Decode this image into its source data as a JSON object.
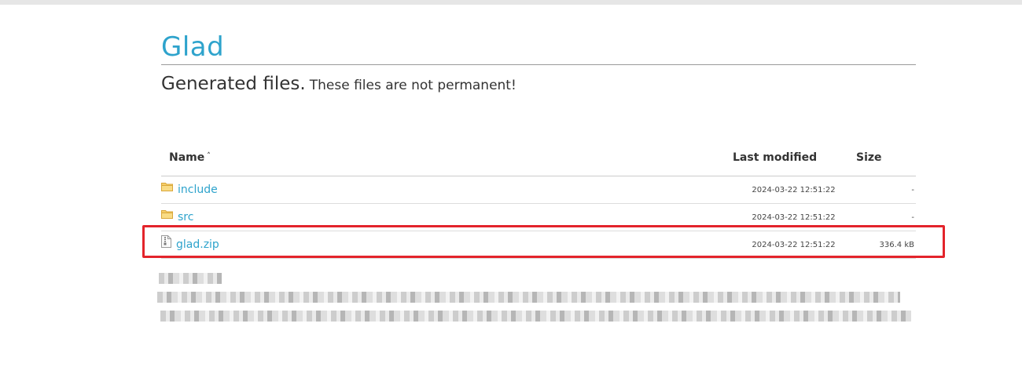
{
  "header": {
    "title": "Glad",
    "subtitle_main": "Generated files.",
    "subtitle_note": "These files are not permanent!"
  },
  "listing": {
    "columns": {
      "name": "Name",
      "sort_indicator": "˄",
      "last_modified": "Last modified",
      "size": "Size"
    },
    "rows": [
      {
        "name": "include",
        "type": "folder",
        "modified": "2024-03-22 12:51:22",
        "size": "-",
        "icon": "folder-icon"
      },
      {
        "name": "src",
        "type": "folder",
        "modified": "2024-03-22 12:51:22",
        "size": "-",
        "icon": "folder-icon"
      },
      {
        "name": "glad.zip",
        "type": "file",
        "modified": "2024-03-22 12:51:22",
        "size": "336.4 kB",
        "icon": "zip-file-icon"
      }
    ]
  },
  "colors": {
    "link": "#2ea3cc",
    "highlight": "#e3242b",
    "folder": "#f2c14e"
  }
}
